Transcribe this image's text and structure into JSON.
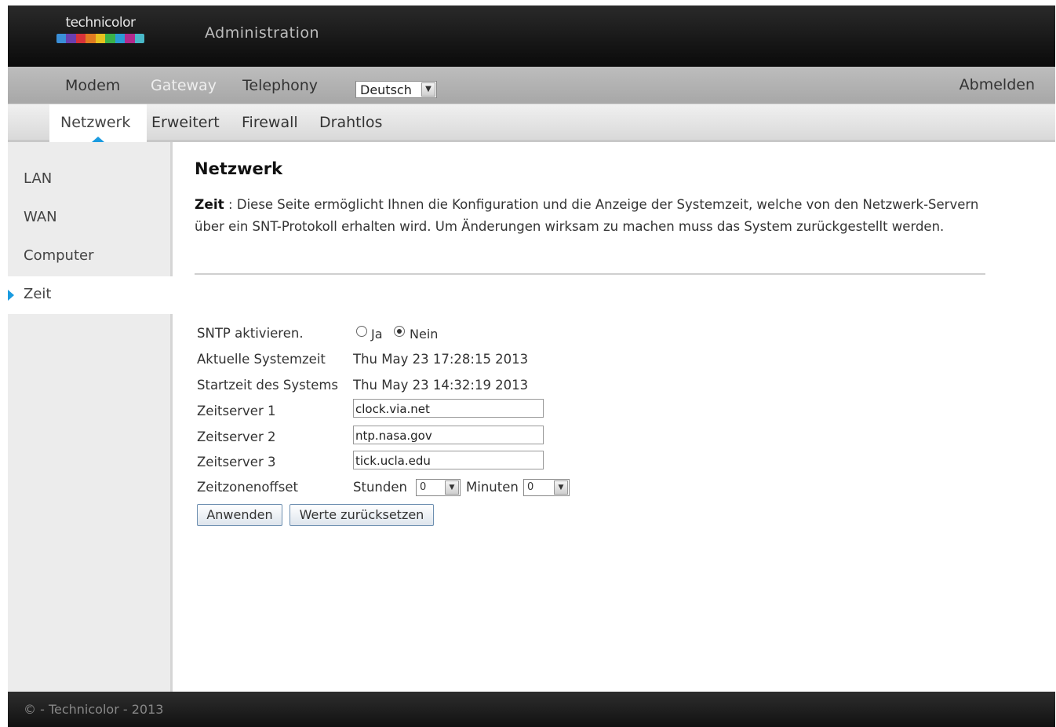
{
  "header": {
    "logo_text": "technicolor",
    "logo_colors": [
      "#3a8fd8",
      "#6a3fb0",
      "#d8323a",
      "#e07b21",
      "#e7c21f",
      "#3ab24a",
      "#2a9bd6",
      "#b22a8c",
      "#49b8c8"
    ],
    "app_title": "Administration"
  },
  "mainnav": {
    "items": [
      "Modem",
      "Gateway",
      "Telephony"
    ],
    "active": "Gateway",
    "language": "Deutsch",
    "logout": "Abmelden"
  },
  "subnav": {
    "items": [
      "Netzwerk",
      "Erweitert",
      "Firewall",
      "Drahtlos"
    ],
    "active": "Netzwerk"
  },
  "sidebar": {
    "items": [
      "LAN",
      "WAN",
      "Computer",
      "Zeit"
    ],
    "active": "Zeit"
  },
  "content": {
    "title": "Netzwerk",
    "desc_label": "Zeit",
    "desc_sep": " : ",
    "description": "Diese Seite ermöglicht Ihnen die Konfiguration und die Anzeige der Systemzeit, welche von den Netzwerk-Servern über ein SNT-Protokoll erhalten wird. Um Änderungen wirksam zu machen muss das System zurückgestellt werden."
  },
  "form": {
    "sntp_label": "SNTP aktivieren.",
    "sntp_yes": "Ja",
    "sntp_no": "Nein",
    "sntp_value": "Nein",
    "current_time_label": "Aktuelle Systemzeit",
    "current_time_value": "Thu May 23 17:28:15 2013",
    "start_time_label": "Startzeit des Systems",
    "start_time_value": "Thu May 23 14:32:19 2013",
    "server1_label": "Zeitserver 1",
    "server1_value": "clock.via.net",
    "server2_label": "Zeitserver 2",
    "server2_value": "ntp.nasa.gov",
    "server3_label": "Zeitserver 3",
    "server3_value": "tick.ucla.edu",
    "offset_label": "Zeitzonenoffset",
    "hours_label": "Stunden",
    "hours_value": "0",
    "minutes_label": "Minuten",
    "minutes_value": "0",
    "apply_button": "Anwenden",
    "reset_button": "Werte zurücksetzen"
  },
  "footer": {
    "text": "© - Technicolor - 2013"
  },
  "colors": {
    "accent": "#1a9be0",
    "header_bg": "#111111",
    "nav_bg": "#b0b0b0"
  }
}
